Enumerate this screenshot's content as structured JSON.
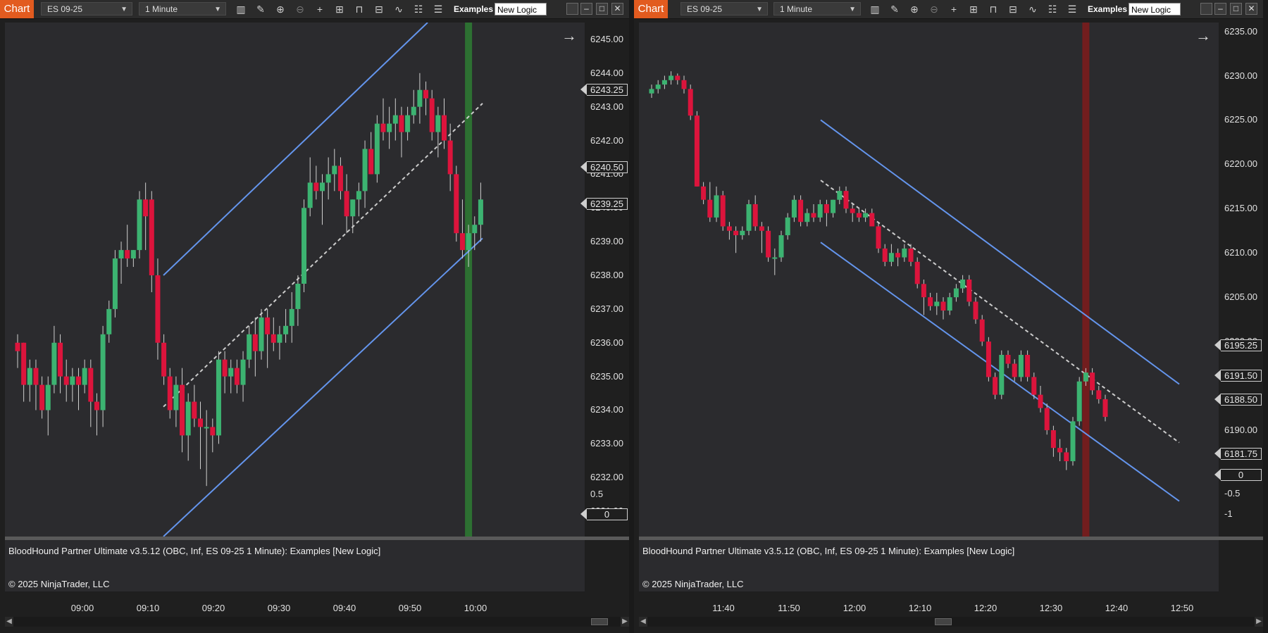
{
  "panels": [
    {
      "chart_tab": "Chart",
      "instrument": "ES 09-25",
      "interval": "1 Minute",
      "examples_label": "Examples",
      "logic_value": "New Logic",
      "price_ticks": [
        "6245.00",
        "6244.00",
        "6243.00",
        "6242.00",
        "6241.00",
        "6240.00",
        "6239.00",
        "6238.00",
        "6237.00",
        "6236.00",
        "6235.00",
        "6234.00",
        "6233.00",
        "6232.00",
        "6231.00"
      ],
      "price_tags": [
        "6243.25",
        "6240.50",
        "6239.25"
      ],
      "indicator_title": "BloodHound Partner Ultimate v3.5.12 (OBC, Inf, ES 09-25 1 Minute): Examples  [New Logic]",
      "copyright": "© 2025 NinjaTrader, LLC",
      "sub_ticks": [
        "0.5"
      ],
      "sub_tags": [
        "0"
      ],
      "time_labels": [
        "09:00",
        "09:10",
        "09:20",
        "09:30",
        "09:40",
        "09:50",
        "10:00"
      ],
      "colors": {
        "up": "#3cb371",
        "down": "#dc143c",
        "channel": "#6495ed",
        "signal": "#2e7d32",
        "signal_sub": "#32cd32",
        "sub_line": "#9acd32"
      }
    },
    {
      "chart_tab": "Chart",
      "instrument": "ES 09-25",
      "interval": "1 Minute",
      "examples_label": "Examples",
      "logic_value": "New Logic",
      "price_ticks": [
        "6235.00",
        "6230.00",
        "6225.00",
        "6220.00",
        "6215.00",
        "6210.00",
        "6205.00",
        "6200.00",
        "6190.00",
        "6185.00"
      ],
      "price_tags": [
        "6195.25",
        "6191.50",
        "6188.50",
        "6181.75"
      ],
      "indicator_title": "BloodHound Partner Ultimate v3.5.12 (OBC, Inf, ES 09-25 1 Minute): Examples  [New Logic]",
      "copyright": "© 2025 NinjaTrader, LLC",
      "sub_ticks": [
        "-0.5",
        "-1"
      ],
      "sub_tags": [
        "0"
      ],
      "time_labels": [
        "11:40",
        "11:50",
        "12:00",
        "12:10",
        "12:20",
        "12:30",
        "12:40",
        "12:50"
      ],
      "colors": {
        "up": "#3cb371",
        "down": "#dc143c",
        "channel": "#6495ed",
        "signal": "#8b1a1a",
        "signal_sub": "#ff0000",
        "sub_line": "#ff4500"
      }
    }
  ],
  "chart_data": [
    {
      "type": "candlestick",
      "instrument": "ES 09-25",
      "interval": "1 Minute",
      "ylim": [
        6230.25,
        6245.5
      ],
      "x": [
        "09:00",
        "09:10",
        "09:20",
        "09:30",
        "09:40",
        "09:50",
        "10:00"
      ],
      "candles": [
        [
          6236,
          6236.25,
          6235.25,
          6235.75
        ],
        [
          6236,
          6236,
          6234.25,
          6234.75
        ],
        [
          6234.75,
          6235.5,
          6234.25,
          6235.25
        ],
        [
          6235.25,
          6235.5,
          6234,
          6234.75
        ],
        [
          6234.75,
          6235,
          6233.75,
          6234
        ],
        [
          6234,
          6235,
          6233.25,
          6234.75
        ],
        [
          6234.75,
          6236.5,
          6234.5,
          6236
        ],
        [
          6236,
          6236.25,
          6234.5,
          6235
        ],
        [
          6235,
          6235.5,
          6234.25,
          6234.75
        ],
        [
          6234.75,
          6235.25,
          6234.25,
          6235
        ],
        [
          6235,
          6235.25,
          6234,
          6234.75
        ],
        [
          6234.75,
          6235.5,
          6234.5,
          6235.25
        ],
        [
          6235.25,
          6235.5,
          6233.5,
          6234.25
        ],
        [
          6234.25,
          6234.5,
          6233.25,
          6234
        ],
        [
          6234,
          6236.5,
          6233.5,
          6236.25
        ],
        [
          6236.25,
          6237.25,
          6236,
          6237
        ],
        [
          6237,
          6238.75,
          6236.75,
          6238.5
        ],
        [
          6238.5,
          6239,
          6237.75,
          6238.75
        ],
        [
          6238.75,
          6239.5,
          6238.25,
          6238.5
        ],
        [
          6238.5,
          6238.75,
          6238.25,
          6238.75
        ],
        [
          6238.75,
          6240.5,
          6238.5,
          6240.25
        ],
        [
          6240.25,
          6240.75,
          6238.75,
          6239.75
        ],
        [
          6240.25,
          6240.5,
          6237.5,
          6238
        ],
        [
          6238,
          6238.5,
          6235.5,
          6236
        ],
        [
          6236,
          6236.25,
          6234.75,
          6235
        ],
        [
          6235,
          6235.25,
          6233.75,
          6234
        ],
        [
          6234,
          6235,
          6233.5,
          6234.75
        ],
        [
          6234.75,
          6235.25,
          6232.75,
          6233.25
        ],
        [
          6233.25,
          6234.5,
          6232.5,
          6234.25
        ],
        [
          6234.25,
          6234.75,
          6233.5,
          6233.75
        ],
        [
          6233.75,
          6234.25,
          6232.25,
          6233.5
        ],
        [
          6233.5,
          6234,
          6231.75,
          6233.5
        ],
        [
          6233.5,
          6233.75,
          6232.75,
          6233.25
        ],
        [
          6233.25,
          6235.75,
          6233,
          6235.5
        ],
        [
          6235.5,
          6235.75,
          6234.5,
          6235
        ],
        [
          6235,
          6235.5,
          6234.5,
          6235.25
        ],
        [
          6235.25,
          6235.5,
          6234.5,
          6234.75
        ],
        [
          6234.75,
          6235.75,
          6234.25,
          6235.5
        ],
        [
          6235.5,
          6236.5,
          6235.25,
          6236.25
        ],
        [
          6236.25,
          6236.75,
          6235,
          6235.75
        ],
        [
          6235.75,
          6237,
          6235.5,
          6236.75
        ],
        [
          6236.75,
          6237,
          6235.25,
          6236.25
        ],
        [
          6236.25,
          6236.75,
          6235.75,
          6236
        ],
        [
          6236,
          6236.5,
          6235.5,
          6236.25
        ],
        [
          6236.25,
          6237,
          6236,
          6236.5
        ],
        [
          6236.5,
          6237.5,
          6236,
          6237
        ],
        [
          6237,
          6238,
          6236.5,
          6237.75
        ],
        [
          6237.75,
          6240.25,
          6237.5,
          6240
        ],
        [
          6240,
          6241.5,
          6239.75,
          6240.75
        ],
        [
          6240.75,
          6241.25,
          6240.25,
          6240.5
        ],
        [
          6240.5,
          6241,
          6239.5,
          6240.75
        ],
        [
          6240.75,
          6241.5,
          6240.25,
          6241
        ],
        [
          6241,
          6241.75,
          6240.5,
          6241.25
        ],
        [
          6241.25,
          6241.5,
          6240.25,
          6240.5
        ],
        [
          6240.5,
          6241,
          6239.25,
          6239.75
        ],
        [
          6239.75,
          6240.25,
          6239.25,
          6240.25
        ],
        [
          6240.25,
          6240.75,
          6239.75,
          6240.5
        ],
        [
          6240.5,
          6242,
          6240,
          6241.75
        ],
        [
          6241.75,
          6242.25,
          6241,
          6241
        ],
        [
          6241,
          6242.75,
          6240.75,
          6242.5
        ],
        [
          6242.5,
          6243.25,
          6242,
          6242.25
        ],
        [
          6242.25,
          6243,
          6241.75,
          6242.5
        ],
        [
          6242.5,
          6243.25,
          6242,
          6242.75
        ],
        [
          6242.75,
          6243,
          6241.5,
          6242.25
        ],
        [
          6242.25,
          6243,
          6242,
          6242.75
        ],
        [
          6242.75,
          6243.5,
          6242.5,
          6243
        ],
        [
          6243,
          6244,
          6242.5,
          6243.5
        ],
        [
          6243.5,
          6243.75,
          6242.75,
          6243.25
        ],
        [
          6243.25,
          6243.5,
          6242,
          6242.25
        ],
        [
          6242.25,
          6243,
          6241.5,
          6242.75
        ],
        [
          6242.75,
          6243.25,
          6241.75,
          6242
        ],
        [
          6242,
          6242.5,
          6240.5,
          6241
        ],
        [
          6241,
          6241.25,
          6239,
          6239.25
        ],
        [
          6239.25,
          6240.25,
          6238.5,
          6238.75
        ],
        [
          6238.75,
          6239.5,
          6238.25,
          6239.25
        ],
        [
          6239.25,
          6239.75,
          6238.75,
          6239.5
        ],
        [
          6239.5,
          6240.75,
          6239,
          6240.25
        ]
      ],
      "channel_upper": [
        [
          6238,
          6245.5
        ],
        [
          6245.5,
          6245.5
        ]
      ],
      "channel_lower": [
        [
          6230.5,
          6239.25
        ]
      ],
      "signal_bar_index": 74,
      "sub_ylim": [
        0,
        1
      ]
    },
    {
      "type": "candlestick",
      "instrument": "ES 09-25",
      "interval": "1 Minute",
      "ylim": [
        6178.0,
        6236.0
      ],
      "x": [
        "11:40",
        "11:50",
        "12:00",
        "12:10",
        "12:20",
        "12:30",
        "12:40",
        "12:50"
      ],
      "candles": [
        [
          6228,
          6229,
          6227.5,
          6228.5
        ],
        [
          6228.5,
          6229.5,
          6228,
          6229
        ],
        [
          6229,
          6230,
          6228.5,
          6229.5
        ],
        [
          6229.5,
          6230.5,
          6229,
          6230
        ],
        [
          6230,
          6230.25,
          6229,
          6229.5
        ],
        [
          6229.5,
          6230,
          6228,
          6228.5
        ],
        [
          6228.5,
          6229,
          6225,
          6225.5
        ],
        [
          6225.5,
          6226,
          6217.5,
          6217.5
        ],
        [
          6217.5,
          6218,
          6215.5,
          6216
        ],
        [
          6216,
          6218,
          6213.5,
          6214
        ],
        [
          6214,
          6217.5,
          6213.5,
          6216.5
        ],
        [
          6216.5,
          6217,
          6212.5,
          6213
        ],
        [
          6213,
          6213.5,
          6211.5,
          6212.5
        ],
        [
          6212.5,
          6213,
          6210,
          6212
        ],
        [
          6212,
          6213,
          6211.5,
          6212.5
        ],
        [
          6212.5,
          6216,
          6212,
          6215.5
        ],
        [
          6215.5,
          6216.5,
          6212.5,
          6213
        ],
        [
          6213,
          6213.5,
          6210,
          6212.5
        ],
        [
          6212.5,
          6213,
          6209,
          6209.5
        ],
        [
          6209.5,
          6210.5,
          6207.5,
          6209.5
        ],
        [
          6209.5,
          6212.5,
          6209,
          6212
        ],
        [
          6212,
          6214.5,
          6211.5,
          6214
        ],
        [
          6214,
          6216.5,
          6213.5,
          6216
        ],
        [
          6216,
          6216.5,
          6213,
          6213.5
        ],
        [
          6213.5,
          6215,
          6213,
          6214.5
        ],
        [
          6214.5,
          6215.5,
          6213.5,
          6214
        ],
        [
          6214,
          6216,
          6213.5,
          6215.5
        ],
        [
          6215.5,
          6216,
          6213,
          6214.5
        ],
        [
          6214.5,
          6216,
          6214,
          6216
        ],
        [
          6216,
          6217.5,
          6215.5,
          6217
        ],
        [
          6217,
          6217.5,
          6214.5,
          6215
        ],
        [
          6215,
          6215.5,
          6213.5,
          6214.5
        ],
        [
          6214.5,
          6215,
          6213.5,
          6214
        ],
        [
          6214,
          6215,
          6213.5,
          6214.5
        ],
        [
          6214.5,
          6215,
          6213,
          6213
        ],
        [
          6213,
          6213.5,
          6210,
          6210.5
        ],
        [
          6210.5,
          6211,
          6208.5,
          6209
        ],
        [
          6209,
          6211,
          6208.5,
          6210
        ],
        [
          6210,
          6210.5,
          6208.5,
          6209.5
        ],
        [
          6209.5,
          6211,
          6209,
          6210.5
        ],
        [
          6210.5,
          6211,
          6208.5,
          6209
        ],
        [
          6209,
          6209.5,
          6206,
          6206.5
        ],
        [
          6206.5,
          6207,
          6203,
          6205
        ],
        [
          6205,
          6205.5,
          6203.5,
          6204
        ],
        [
          6204,
          6205.5,
          6203,
          6204.5
        ],
        [
          6204.5,
          6205,
          6202.5,
          6203.5
        ],
        [
          6203.5,
          6205.5,
          6203,
          6205
        ],
        [
          6205,
          6206.5,
          6204.5,
          6206
        ],
        [
          6206,
          6207.5,
          6205.5,
          6207
        ],
        [
          6207,
          6207.5,
          6204,
          6204.5
        ],
        [
          6204.5,
          6205,
          6202,
          6202.5
        ],
        [
          6202.5,
          6203,
          6199.5,
          6200
        ],
        [
          6200,
          6200.5,
          6195.5,
          6196
        ],
        [
          6196,
          6196.5,
          6193.5,
          6194
        ],
        [
          6194,
          6199,
          6193.5,
          6198.5
        ],
        [
          6198.5,
          6199,
          6197,
          6197.5
        ],
        [
          6197.5,
          6198,
          6195.5,
          6196
        ],
        [
          6196,
          6199,
          6195.5,
          6198.5
        ],
        [
          6198.5,
          6199,
          6195.5,
          6196
        ],
        [
          6196,
          6196.5,
          6193.5,
          6194
        ],
        [
          6194,
          6195,
          6192,
          6192.5
        ],
        [
          6192.5,
          6193,
          6189.5,
          6190
        ],
        [
          6190,
          6190.5,
          6187,
          6188
        ],
        [
          6188,
          6189,
          6186.5,
          6187.5
        ],
        [
          6187.5,
          6188,
          6185.5,
          6186.5
        ],
        [
          6186.5,
          6191.5,
          6186,
          6191
        ],
        [
          6191,
          6196,
          6190.5,
          6195.5
        ],
        [
          6195.5,
          6197,
          6195,
          6196.5
        ],
        [
          6196.5,
          6197,
          6194,
          6194.5
        ],
        [
          6194.5,
          6195,
          6193,
          6193.5
        ],
        [
          6193.5,
          6194,
          6191,
          6191.5
        ]
      ],
      "signal_bar_index": 67,
      "sub_ylim": [
        -1,
        0
      ]
    }
  ]
}
